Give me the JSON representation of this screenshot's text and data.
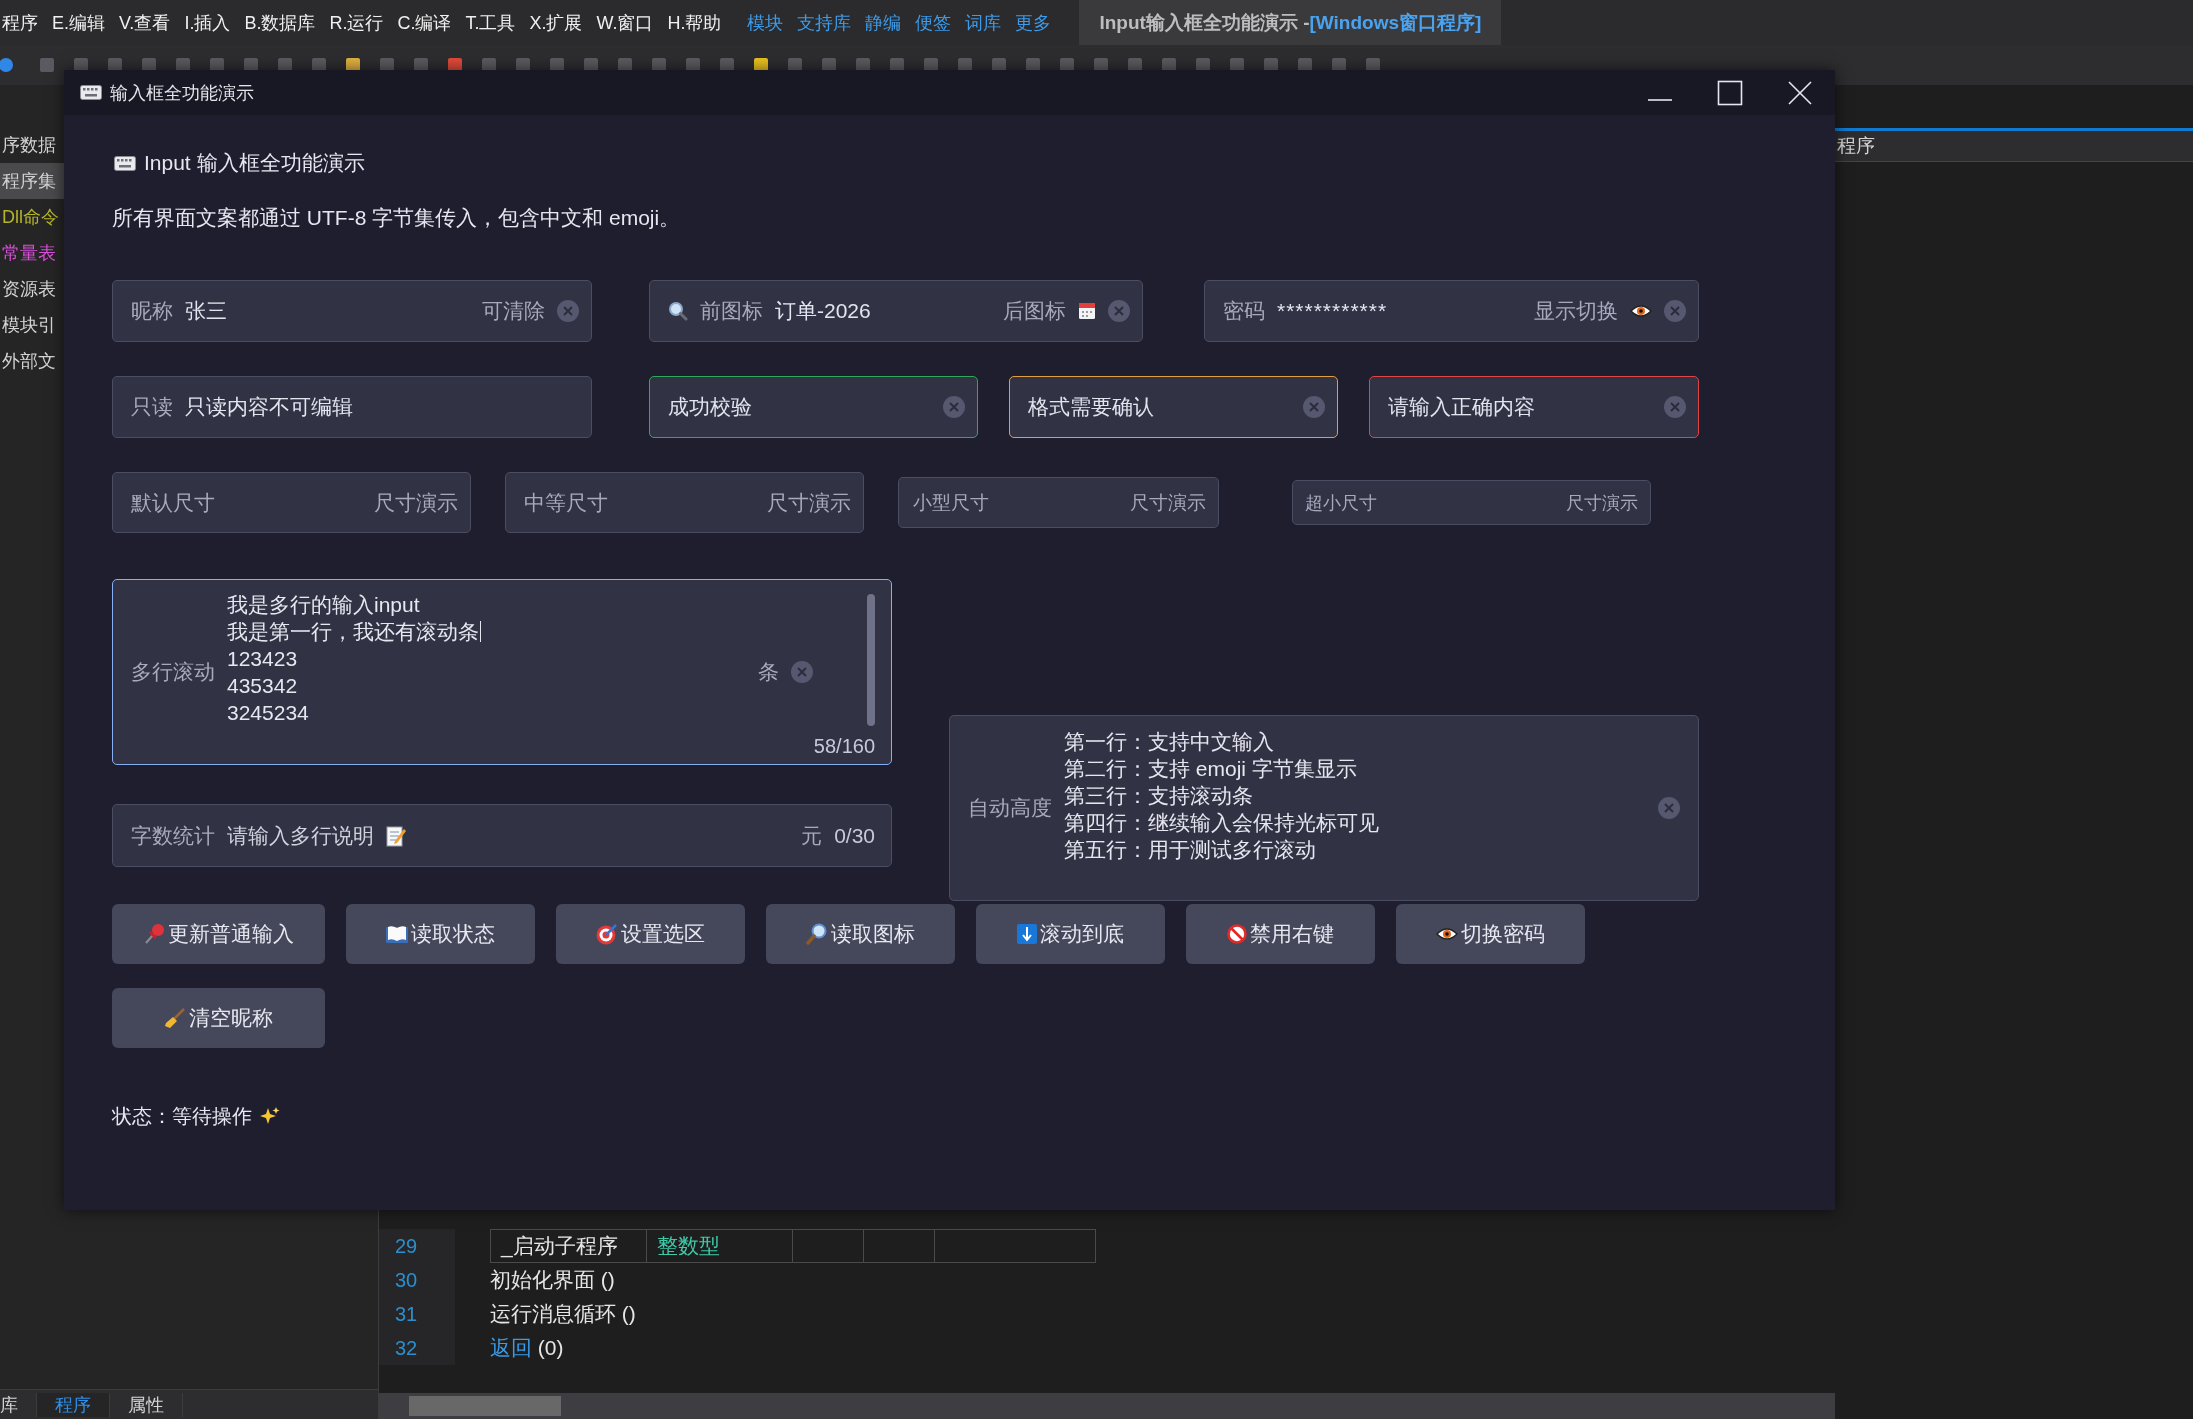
{
  "ide": {
    "menu": [
      "程序",
      "E.编辑",
      "V.查看",
      "I.插入",
      "B.数据库",
      "R.运行",
      "C.编译",
      "T.工具",
      "X.扩展",
      "W.窗口",
      "H.帮助"
    ],
    "quick_links": [
      "模块",
      "支持库",
      "静编",
      "便签",
      "词库",
      "更多"
    ],
    "document_tab": {
      "title": "Input输入框全功能演示 - ",
      "project": "[Windows窗口程序]"
    },
    "sidebar_items": [
      {
        "label": "序数据",
        "color": "#d4d4d4",
        "selected": false
      },
      {
        "label": "程序集",
        "color": "#d0d0d0",
        "selected": true
      },
      {
        "label": "Dll命令",
        "color": "#b5b52a",
        "selected": false
      },
      {
        "label": "常量表",
        "color": "#d94fd9",
        "selected": false
      },
      {
        "label": "资源表",
        "color": "#d4d4d4",
        "selected": false
      },
      {
        "label": "模块引",
        "color": "#d4d4d4",
        "selected": false
      },
      {
        "label": "外部文",
        "color": "#d4d4d4",
        "selected": false
      }
    ],
    "side_panel_title": "程序",
    "code_lines": [
      {
        "line": "29",
        "kind": "table",
        "cells": [
          "_启动子程序",
          "整数型"
        ]
      },
      {
        "line": "30",
        "kind": "call",
        "text": "初始化界面 ()"
      },
      {
        "line": "31",
        "kind": "call",
        "text": "运行消息循环 ()"
      },
      {
        "line": "32",
        "kind": "return",
        "keyword": "返回",
        "args": "(0)"
      }
    ],
    "bottom_tabs": [
      {
        "label": "库",
        "selected": false
      },
      {
        "label": "程序",
        "selected": true
      },
      {
        "label": "属性",
        "selected": false
      }
    ]
  },
  "dialog": {
    "title": "输入框全功能演示",
    "heading": "Input 输入框全功能演示",
    "description": "所有界面文案都通过 UTF-8 字节集传入，包含中文和 emoji。",
    "field_rows": [
      [
        {
          "kind": "plain",
          "label": "昵称",
          "value": "张三",
          "suffix": "可清除",
          "clearable": true
        },
        {
          "kind": "icons",
          "label": "前图标",
          "value": "订单-2026",
          "suffix": "后图标",
          "clearable": true
        },
        {
          "kind": "password",
          "label": "密码",
          "value": "************",
          "suffix": "显示切换",
          "clearable": true
        }
      ],
      [
        {
          "kind": "plain",
          "label": "只读",
          "value": "只读内容不可编辑",
          "clearable": false
        },
        {
          "kind": "success",
          "value": "成功校验",
          "clearable": true
        },
        {
          "kind": "warning",
          "value": "格式需要确认",
          "clearable": true
        },
        {
          "kind": "error",
          "value": "请输入正确内容",
          "clearable": true
        }
      ]
    ],
    "size_fields": [
      {
        "kind": "default",
        "placeholder": "默认尺寸",
        "suffix": "尺寸演示"
      },
      {
        "kind": "medium",
        "placeholder": "中等尺寸",
        "suffix": "尺寸演示"
      },
      {
        "kind": "small",
        "placeholder": "小型尺寸",
        "suffix": "尺寸演示"
      },
      {
        "kind": "mini",
        "placeholder": "超小尺寸",
        "suffix": "尺寸演示"
      }
    ],
    "multiline": {
      "label": "多行滚动",
      "focused": true,
      "lines": [
        {
          "text": "我是多行的输入input",
          "cursor": false
        },
        {
          "text": "我是第一行，我还有滚动条",
          "cursor": true
        },
        {
          "text": "123423",
          "cursor": false
        },
        {
          "text": "435342",
          "cursor": false
        },
        {
          "text": "3245234",
          "cursor": false
        }
      ],
      "suffix": "条",
      "clearable": true,
      "count": "58/160"
    },
    "word_count": {
      "label": "字数统计",
      "placeholder": "请输入多行说明",
      "suffix": "元",
      "count": "0/30"
    },
    "autosize": {
      "label": "自动高度",
      "lines": [
        "第一行：支持中文输入",
        "第二行：支持 emoji 字节集显示",
        "第三行：支持滚动条",
        "第四行：继续输入会保持光标可见",
        "第五行：用于测试多行滚动"
      ],
      "clearable": true
    },
    "buttons": [
      "更新普通输入",
      "读取状态",
      "设置选区",
      "读取图标",
      "滚动到底",
      "禁用右键",
      "切换密码",
      "清空昵称"
    ],
    "status": "状态：等待操作"
  }
}
